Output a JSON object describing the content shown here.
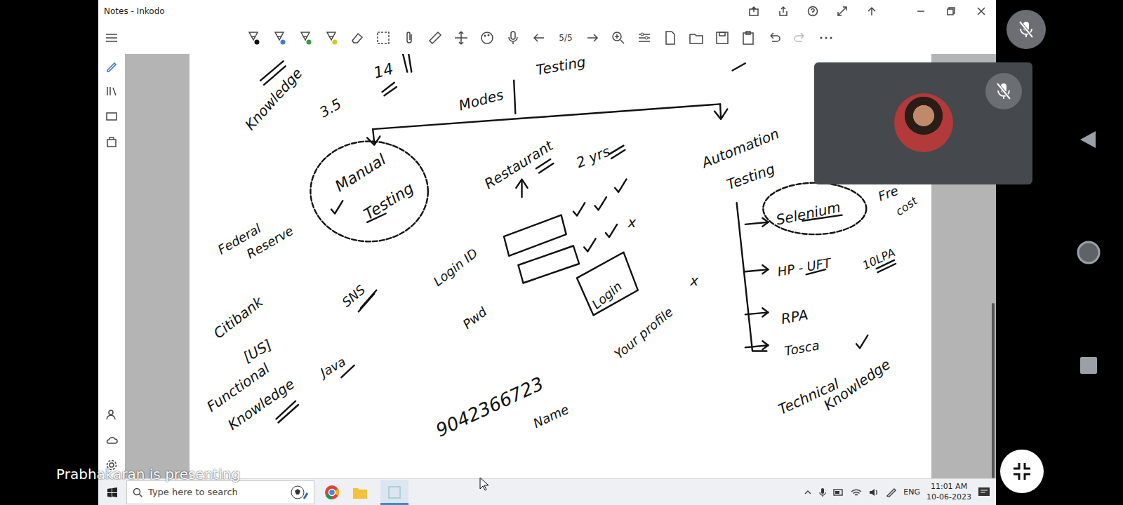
{
  "window": {
    "title": "Notes - Inkodo"
  },
  "toolbar": {
    "page": "5/5"
  },
  "notes": [
    "Knowledge",
    "14",
    "3.5",
    "Modes",
    "Testing",
    "Manual",
    "Testing",
    "Restaurant",
    "2 yrs",
    "Automation",
    "Testing",
    "Selenium",
    "Fre",
    "cost",
    "HP - UFT",
    "10LPA",
    "RPA",
    "Tosca",
    "Technical",
    "Knowledge",
    "Federal",
    "Reserve",
    "Citibank",
    "[US]",
    "SNS",
    "Login ID",
    "Pwd",
    "Login",
    "Your profile",
    "x",
    "x",
    "Java",
    "Functional",
    "Knowledge",
    "9042366723",
    "Name"
  ],
  "participant": {
    "mic_muted": true
  },
  "presenter": {
    "label": "Prabhakaran is presenting",
    "mic_muted": true
  },
  "taskbar": {
    "search": "Type here to search",
    "language": "ENG",
    "time": "11:01 AM",
    "date": "10-06-2023"
  }
}
